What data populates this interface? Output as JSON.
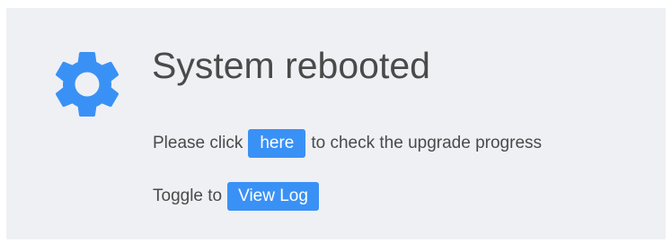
{
  "notice": {
    "icon": "gear-icon",
    "accent_color": "#3a91f5",
    "title": "System rebooted",
    "line1": {
      "before": "Please click",
      "link_label": "here",
      "after": "to check the upgrade progress"
    },
    "line2": {
      "before": "Toggle to",
      "button_label": "View Log"
    }
  }
}
